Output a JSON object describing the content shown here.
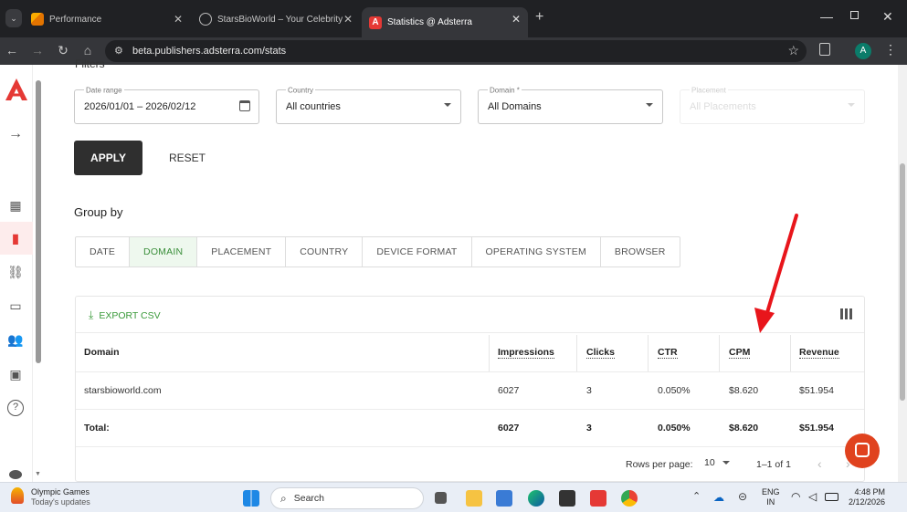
{
  "browser": {
    "tabs": [
      {
        "title": "Performance",
        "active": false
      },
      {
        "title": "StarsBioWorld – Your Celebrity I",
        "active": false
      },
      {
        "title": "Statistics @ Adsterra",
        "active": true
      }
    ],
    "url": "beta.publishers.adsterra.com/stats",
    "avatar_letter": "A"
  },
  "filters": {
    "heading": "Filters",
    "date_range": {
      "label": "Date range",
      "value": "2026/01/01 – 2026/02/12"
    },
    "country": {
      "label": "Country",
      "value": "All countries"
    },
    "domain": {
      "label": "Domain *",
      "value": "All Domains"
    },
    "placement": {
      "label": "Placement",
      "value": "All Placements"
    },
    "apply_label": "APPLY",
    "reset_label": "RESET"
  },
  "group_by": {
    "heading": "Group by",
    "tabs": [
      "DATE",
      "DOMAIN",
      "PLACEMENT",
      "COUNTRY",
      "DEVICE FORMAT",
      "OPERATING SYSTEM",
      "BROWSER"
    ],
    "selected": "DOMAIN"
  },
  "table": {
    "export_label": "EXPORT CSV",
    "columns": [
      "Domain",
      "Impressions",
      "Clicks",
      "CTR",
      "CPM",
      "Revenue"
    ],
    "rows": [
      [
        "starsbioworld.com",
        "6027",
        "3",
        "0.050%",
        "$8.620",
        "$51.954"
      ]
    ],
    "total": [
      "Total:",
      "6027",
      "3",
      "0.050%",
      "$8.620",
      "$51.954"
    ],
    "rows_per_page_label": "Rows per page:",
    "rows_per_page": "10",
    "range": "1–1 of 1"
  },
  "taskbar": {
    "widget_title": "Olympic Games",
    "widget_sub": "Today's updates",
    "search_label": "Search",
    "lang": "ENG",
    "region": "IN",
    "time": "4:48 PM",
    "date": "2/12/2026"
  },
  "colors": {
    "accent_green": "#3a9a3a",
    "brand_red": "#e53935",
    "arrow_red": "#e8151b"
  }
}
